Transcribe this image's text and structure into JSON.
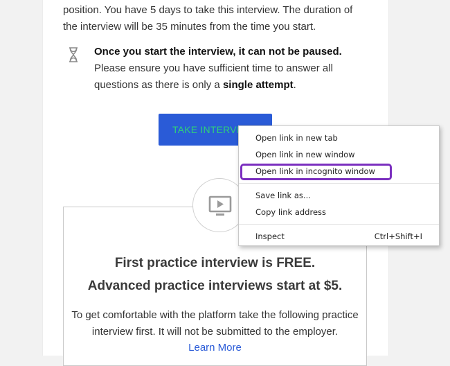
{
  "instructions": {
    "line1": "position. You have 5 days to take this interview. The duration of",
    "line2": "the interview will be 35 minutes from the time you start."
  },
  "note": {
    "icon": "hourglass-icon",
    "bold_line": "Once you start the interview, it can not be paused.",
    "text_before": "Please ensure you have sufficient time to answer all questions as there is only a ",
    "bold_attempt": "single attempt",
    "text_after": "."
  },
  "take_button": {
    "label": "TAKE INTERVIEW"
  },
  "practice": {
    "icon": "video-play-icon",
    "title_line1": "First practice interview is FREE.",
    "title_line2": "Advanced practice interviews start at $5.",
    "body_line1": "To get comfortable with the platform take the following practice",
    "body_line2": "interview first. It will not be submitted to the employer.",
    "learn_more": "Learn More"
  },
  "context_menu": {
    "items": [
      {
        "label": "Open link in new tab"
      },
      {
        "label": "Open link in new window"
      },
      {
        "label": "Open link in incognito window"
      },
      {
        "label": "Save link as..."
      },
      {
        "label": "Copy link address"
      },
      {
        "label": "Inspect",
        "shortcut": "Ctrl+Shift+I"
      }
    ],
    "highlight_color": "#7b2fbf"
  },
  "colors": {
    "button_bg": "#2a5bd7",
    "button_text": "#2fd07a",
    "link": "#2a5bd7"
  }
}
